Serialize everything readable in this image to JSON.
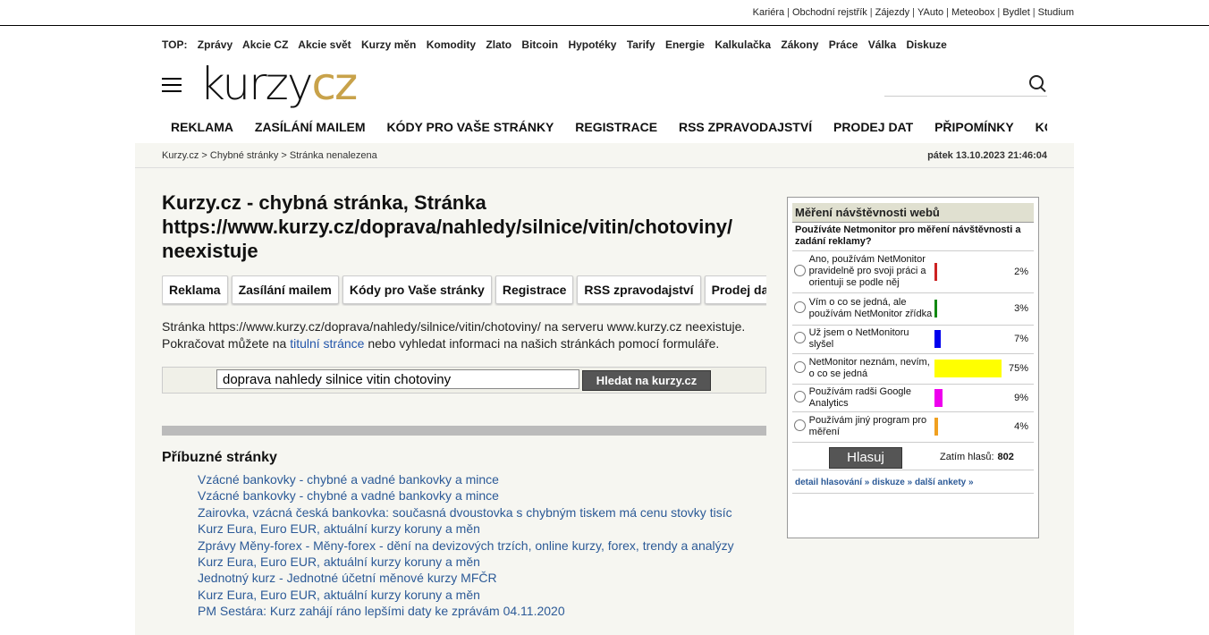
{
  "toplinks": [
    "Kariéra",
    "Obchodní rejstřík",
    "Zájezdy",
    "YAuto",
    "Meteobox",
    "Bydlet",
    "Studium"
  ],
  "topnav": {
    "label": "TOP:",
    "items": [
      "Zprávy",
      "Akcie CZ",
      "Akcie svět",
      "Kurzy měn",
      "Komodity",
      "Zlato",
      "Bitcoin",
      "Hypotéky",
      "Tarify",
      "Energie",
      "Kalkulačka",
      "Zákony",
      "Práce",
      "Válka",
      "Diskuze"
    ]
  },
  "logo": {
    "part1": "kurzy",
    "part2": "cz"
  },
  "mainnav": [
    "REKLAMA",
    "ZASÍLÁNÍ MAILEM",
    "KÓDY PRO VAŠE STRÁNKY",
    "REGISTRACE",
    "RSS ZPRAVODAJSTVÍ",
    "PRODEJ DAT",
    "PŘIPOMÍNKY",
    "KONTAKTY"
  ],
  "breadcrumb": {
    "items": [
      "Kurzy.cz",
      "Chybné stránky",
      "Stránka nenalezena"
    ],
    "sep": " > "
  },
  "date": "pátek 13.10.2023 21:46:04",
  "heading": {
    "line1": "Kurzy.cz - chybná stránka, Stránka",
    "line2": "https://www.kurzy.cz/doprava/nahledy/silnice/vitin/chotoviny/",
    "line3": "neexistuje"
  },
  "buttons": [
    "Reklama",
    "Zasílání mailem",
    "Kódy pro Vaše stránky",
    "Registrace",
    "RSS zpravodajství",
    "Prodej dat"
  ],
  "message": {
    "before": "Stránka https://www.kurzy.cz/doprava/nahledy/silnice/vitin/chotoviny/ na serveru www.kurzy.cz neexistuje. Pokračovat můžete na ",
    "link": "titulní stránce",
    "after": " nebo vyhledat informaci na našich stránkách pomocí formuláře."
  },
  "search": {
    "value": "doprava nahledy silnice vitin chotoviny",
    "button": "Hledat na kurzy.cz"
  },
  "related": {
    "title": "Příbuzné stránky",
    "items": [
      "Vzácné bankovky - chybné a vadné bankovky a mince",
      "Vzácné bankovky - chybné a vadné bankovky a mince",
      "Zairovka, vzácná česká bankovka: současná dvoustovka s chybným tiskem má cenu stovky tisíc",
      "Kurz Eura, Euro EUR, aktuální kurzy koruny a měn",
      "Zprávy Měny-forex - Měny-forex - dění na devizových trzích, online kurzy, forex, trendy a analýzy",
      "Kurz Eura, Euro EUR, aktuální kurzy koruny a měn",
      "Jednotný kurz - Jednotné účetní měnové kurzy MFČR",
      "Kurz Eura, Euro EUR, aktuální kurzy koruny a měn",
      "PM Sestára: Kurz zahájí ráno lepšími daty ke zprávám 04.11.2020"
    ]
  },
  "poll": {
    "title": "Měření návštěvnosti webů",
    "question": "Používáte Netmonitor pro měření návštěvnosti a zadání reklamy?",
    "options": [
      {
        "text": "Ano, používám NetMonitor pravidelně pro svoji práci a orientuji se podle něj",
        "pct": "2%",
        "value": 2,
        "color": "#cc2222"
      },
      {
        "text": "Vím o co se jedná, ale používám NetMonitor zřídka",
        "pct": "3%",
        "value": 3,
        "color": "#118811"
      },
      {
        "text": "Už jsem o NetMonitoru slyšel",
        "pct": "7%",
        "value": 7,
        "color": "#0000ee"
      },
      {
        "text": "NetMonitor neznám, nevím, o co se jedná",
        "pct": "75%",
        "value": 75,
        "color": "#ffff00"
      },
      {
        "text": "Používám radši Google Analytics",
        "pct": "9%",
        "value": 9,
        "color": "#ee00ee"
      },
      {
        "text": "Používám jiný program pro měření",
        "pct": "4%",
        "value": 4,
        "color": "#f0a020"
      }
    ],
    "vote_button": "Hlasuj",
    "votes_label": "Zatím hlasů:",
    "votes_count": "802",
    "links": [
      "detail hlasování »",
      "diskuze »",
      "další ankety »"
    ]
  }
}
